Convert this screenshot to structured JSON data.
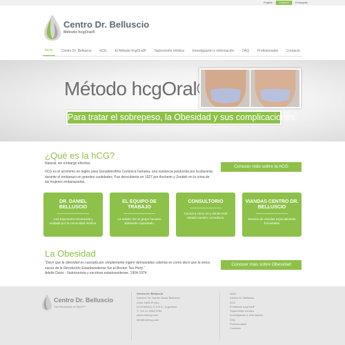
{
  "languages": [
    {
      "label": "English",
      "active": false
    },
    {
      "label": "Español",
      "active": true
    },
    {
      "label": "Português",
      "active": false
    }
  ],
  "logo": {
    "title": "Centro Dr. Belluscio",
    "subtitle": "Método hcgOral®"
  },
  "nav": {
    "items": [
      "Inicio",
      "Centro Dr. Belluscio",
      "hCG",
      "El Método hcgOral®",
      "Supervisión médica",
      "Investigación e información",
      "FAQ",
      "Profesionales",
      "Contacto"
    ],
    "active_index": 0
  },
  "hero": {
    "title": "Método hcgOral®",
    "tagline": "Para tratar el sobrepeso, la Obesidad y sus complicaciones."
  },
  "hcg_section": {
    "title": "¿Qué es la hCG?",
    "subtitle": "Natural, sin embargo efectiva.",
    "body": "hCG es el acrónimo en inglés para Gonadotrofina Coriónica humana, una sustancia producida por la placenta durante el embarazo en grandes cantidades. Fue descubierta en 1927 por Ascheim y Zondek en la orina de las mujeres embarazadas.",
    "button": "Conocer más sobre la hCG"
  },
  "cards": [
    {
      "title": "DR. DANIEL BELLUSCIO",
      "desc": "Una trayectoria reconocida y avalada por la comunidad médica."
    },
    {
      "title": "EL EQUIPO DE TRABAJO",
      "desc": "La solidez de un grupo humano altamente capacitado."
    },
    {
      "title": "CONSULTORIO",
      "desc": "Conozca cómo es y dónde está situado nuestro consultorio."
    },
    {
      "title": "VIANDAS CENTRO DR. BELLUSCIO",
      "desc": "Servicio de viandas especialmente formuladas"
    }
  ],
  "obesidad_section": {
    "title": "La Obesidad",
    "quote": "\"Decir que la obesidad es causada por simplemente ingerir demasiadas calorías es como decir que la única causa de la Revolución Estadounidense fue el Boston Tea Party.\"",
    "author": "Adelle Davis - Nutricionista y escritora estadounidense. 1904-1974.",
    "button": "Conocer más sobre Obesidad"
  },
  "footer": {
    "logo_title": "Centro Dr. Belluscio",
    "logo_subtitle": "The Revolution of Diets™",
    "contact": {
      "heading": "Centro Dr. Belluscio",
      "lines": [
        "Director: Dr. Daniel Oscar Belluscio",
        "Cuyo 1853 8ª piso",
        "(C1106AAC) C.A.B.A., Argentina",
        "T: +54 11 4804 5784",
        "www.onehcg.com",
        "info@onehcg.com"
      ]
    },
    "links": [
      "Inicio",
      "Centro Dr. Belluscio",
      "hCG",
      "El Método hcgOral®",
      "Supervisión médica",
      "Investigación e información",
      "FAQ",
      "Profesionales",
      "Contacto"
    ]
  },
  "colors": {
    "accent": "#8dc149",
    "footer_bg": "#e7e7e7",
    "text": "#555555"
  }
}
